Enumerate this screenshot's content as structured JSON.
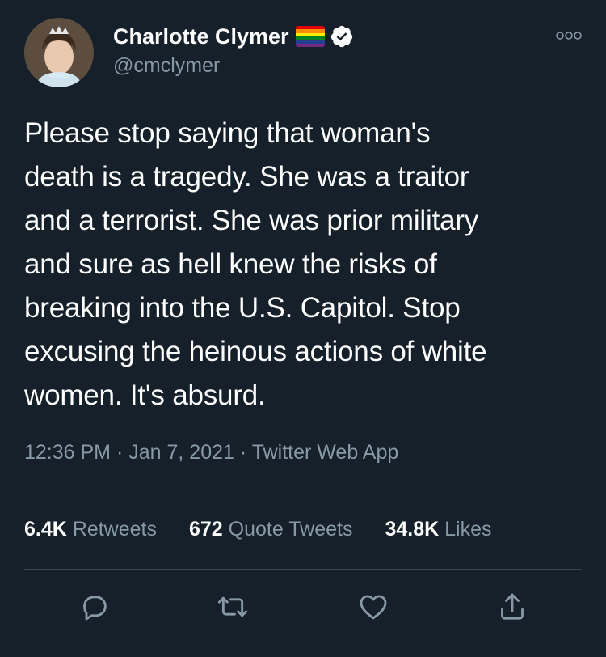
{
  "tweet": {
    "author": {
      "display_name": "Charlotte Clymer",
      "handle": "@cmclymer",
      "badges": [
        "rainbow-flag-emoji",
        "verified-icon"
      ]
    },
    "text": "Please stop saying that woman's\ndeath is a tragedy. She was a traitor\nand a terrorist. She was prior military\nand sure as hell knew the risks of\nbreaking into the U.S. Capitol. Stop\nexcusing the heinous actions of white\nwomen. It's absurd.",
    "meta": {
      "time": "12:36 PM",
      "separator": "·",
      "date": "Jan 7, 2021",
      "source": "Twitter Web App"
    },
    "stats": [
      {
        "count": "6.4K",
        "label": "Retweets"
      },
      {
        "count": "672",
        "label": "Quote Tweets"
      },
      {
        "count": "34.8K",
        "label": "Likes"
      }
    ],
    "actions": [
      "reply-icon",
      "retweet-icon",
      "like-icon",
      "share-icon"
    ],
    "more_menu_icon": "more-options-icon"
  },
  "colors": {
    "background": "#15202b",
    "primary_text": "#ffffff",
    "secondary_text": "#8899a6",
    "divider": "#38444d",
    "verified_badge": "#ffffff"
  }
}
